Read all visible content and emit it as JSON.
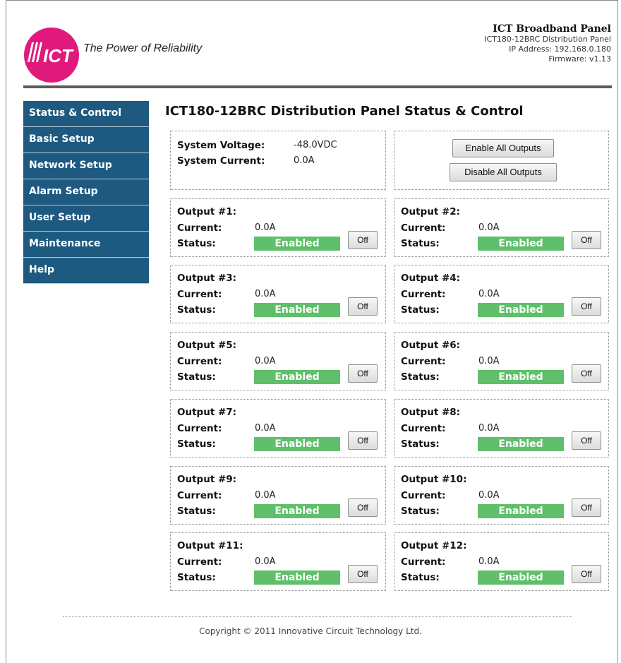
{
  "header": {
    "tagline": "The Power of Reliability",
    "product_title": "ICT Broadband Panel",
    "model_line": "ICT180-12BRC Distribution Panel",
    "ip_line": "IP Address: 192.168.0.180",
    "firmware_line": "Firmware: v1.13",
    "logo_text": "ICT",
    "brand_color": "#e0197d"
  },
  "sidebar": {
    "items": [
      {
        "label": "Status & Control"
      },
      {
        "label": "Basic Setup"
      },
      {
        "label": "Network Setup"
      },
      {
        "label": "Alarm Setup"
      },
      {
        "label": "User Setup"
      },
      {
        "label": "Maintenance"
      },
      {
        "label": "Help"
      }
    ],
    "color": "#1e5a80"
  },
  "main": {
    "title": "ICT180-12BRC Distribution Panel Status & Control",
    "system": {
      "voltage_label": "System Voltage:",
      "voltage_value": "-48.0VDC",
      "current_label": "System Current:",
      "current_value": "0.0A"
    },
    "controls": {
      "enable_all": "Enable All Outputs",
      "disable_all": "Disable All Outputs"
    },
    "current_label": "Current:",
    "status_label": "Status:",
    "outputs": [
      {
        "name": "Output #1:",
        "current": "0.0A",
        "status": "Enabled",
        "button": "Off"
      },
      {
        "name": "Output #2:",
        "current": "0.0A",
        "status": "Enabled",
        "button": "Off"
      },
      {
        "name": "Output #3:",
        "current": "0.0A",
        "status": "Enabled",
        "button": "Off"
      },
      {
        "name": "Output #4:",
        "current": "0.0A",
        "status": "Enabled",
        "button": "Off"
      },
      {
        "name": "Output #5:",
        "current": "0.0A",
        "status": "Enabled",
        "button": "Off"
      },
      {
        "name": "Output #6:",
        "current": "0.0A",
        "status": "Enabled",
        "button": "Off"
      },
      {
        "name": "Output #7:",
        "current": "0.0A",
        "status": "Enabled",
        "button": "Off"
      },
      {
        "name": "Output #8:",
        "current": "0.0A",
        "status": "Enabled",
        "button": "Off"
      },
      {
        "name": "Output #9:",
        "current": "0.0A",
        "status": "Enabled",
        "button": "Off"
      },
      {
        "name": "Output #10:",
        "current": "0.0A",
        "status": "Enabled",
        "button": "Off"
      },
      {
        "name": "Output #11:",
        "current": "0.0A",
        "status": "Enabled",
        "button": "Off"
      },
      {
        "name": "Output #12:",
        "current": "0.0A",
        "status": "Enabled",
        "button": "Off"
      }
    ],
    "status_color": "#5fbf6b"
  },
  "footer": {
    "copyright": "Copyright © 2011 Innovative Circuit Technology Ltd."
  }
}
